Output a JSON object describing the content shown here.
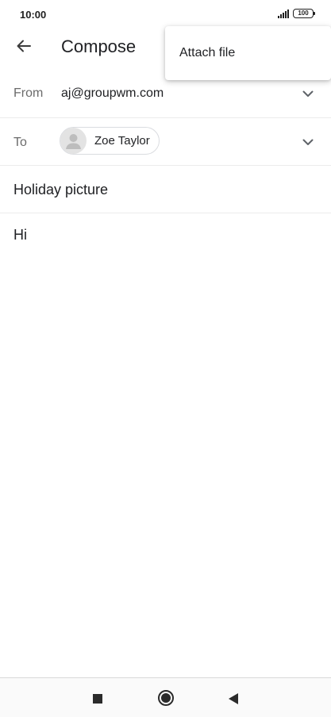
{
  "status_bar": {
    "time": "10:00",
    "battery": "100",
    "icons": [
      "signal-icon",
      "battery-icon"
    ]
  },
  "app_bar": {
    "title": "Compose",
    "back_icon": "arrow-back-icon"
  },
  "overflow_menu": {
    "items": [
      {
        "label": "Attach file"
      }
    ]
  },
  "compose": {
    "from": {
      "label": "From",
      "value": "aj@groupwm.com",
      "icon": "chevron-down-icon"
    },
    "to": {
      "label": "To",
      "recipients": [
        {
          "name": "Zoe Taylor",
          "icon": "person-avatar-icon"
        }
      ],
      "icon": "chevron-down-icon"
    },
    "subject": "Holiday picture",
    "body": "Hi"
  },
  "nav_bar": {
    "icons": [
      "recents-square-icon",
      "home-circle-icon",
      "back-triangle-icon"
    ]
  },
  "colors": {
    "text": "#202124",
    "label": "#6b6b6b",
    "divider": "#ececec",
    "chip_border": "#dadce0"
  }
}
